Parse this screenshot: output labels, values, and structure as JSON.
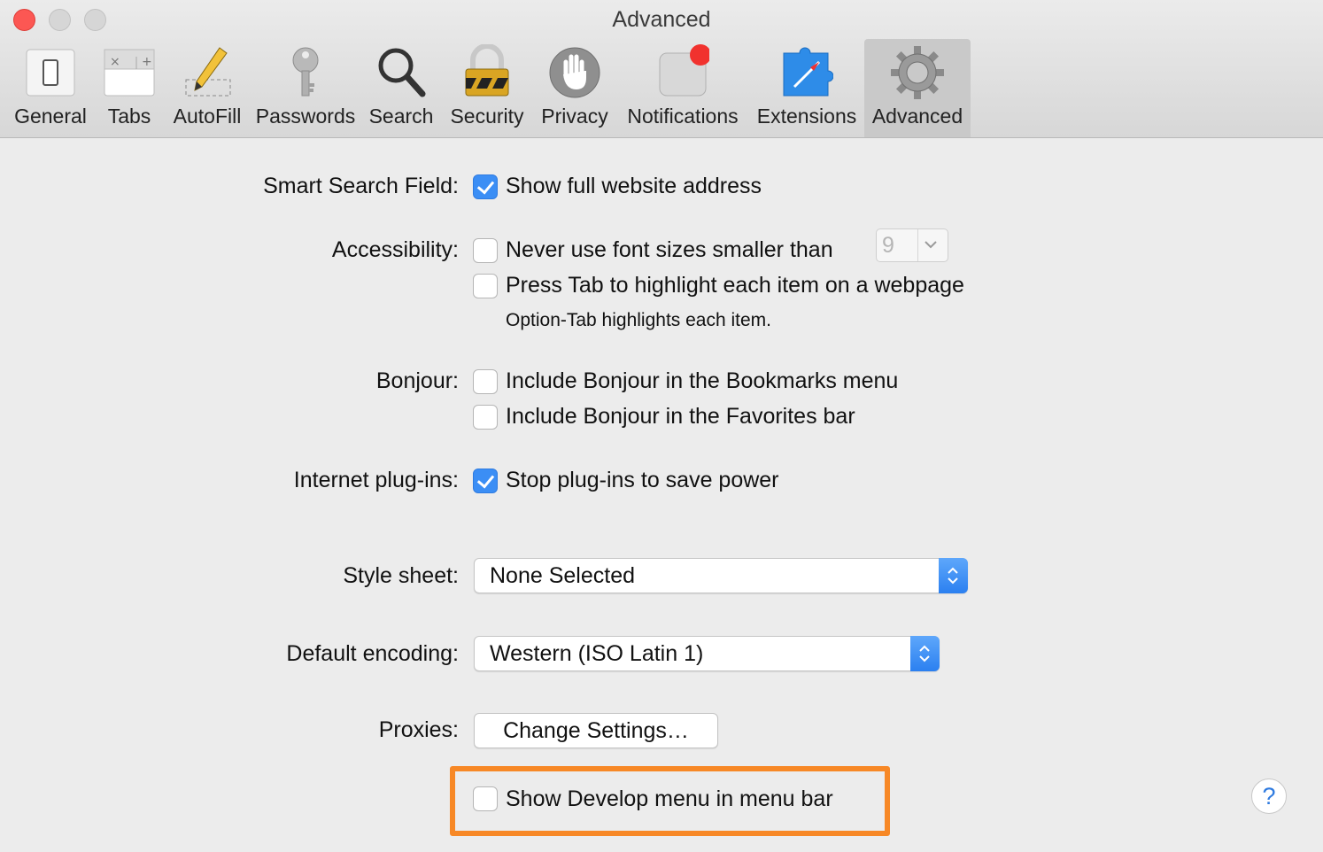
{
  "window": {
    "title": "Advanced"
  },
  "toolbar": {
    "tabs": [
      {
        "label": "General",
        "icon": "general-switch-icon"
      },
      {
        "label": "Tabs",
        "icon": "tabs-icon"
      },
      {
        "label": "AutoFill",
        "icon": "pencil-icon"
      },
      {
        "label": "Passwords",
        "icon": "key-icon"
      },
      {
        "label": "Search",
        "icon": "magnifier-icon"
      },
      {
        "label": "Security",
        "icon": "padlock-icon"
      },
      {
        "label": "Privacy",
        "icon": "hand-icon"
      },
      {
        "label": "Notifications",
        "icon": "notification-icon"
      },
      {
        "label": "Extensions",
        "icon": "puzzle-icon"
      },
      {
        "label": "Advanced",
        "icon": "gear-icon"
      }
    ],
    "selected": "Advanced"
  },
  "settings": {
    "smart_search": {
      "label": "Smart Search Field:",
      "option": "Show full website address",
      "checked": true
    },
    "accessibility": {
      "label": "Accessibility:",
      "font_option": "Never use font sizes smaller than",
      "font_size": "9",
      "font_checked": false,
      "tab_option": "Press Tab to highlight each item on a webpage",
      "tab_checked": false,
      "note": "Option-Tab highlights each item."
    },
    "bonjour": {
      "label": "Bonjour:",
      "bookmarks_option": "Include Bonjour in the Bookmarks menu",
      "favorites_option": "Include Bonjour in the Favorites bar",
      "bookmarks_checked": false,
      "favorites_checked": false
    },
    "plugins": {
      "label": "Internet plug-ins:",
      "option": "Stop plug-ins to save power",
      "checked": true
    },
    "style_sheet": {
      "label": "Style sheet:",
      "value": "None Selected"
    },
    "encoding": {
      "label": "Default encoding:",
      "value": "Western (ISO Latin 1)"
    },
    "proxies": {
      "label": "Proxies:",
      "button": "Change Settings…"
    },
    "develop": {
      "option": "Show Develop menu in menu bar",
      "checked": false
    }
  },
  "help": {
    "label": "?"
  },
  "colors": {
    "accent": "#3b8ef5",
    "highlight_box": "#f78826",
    "close_button": "#fc5753"
  }
}
